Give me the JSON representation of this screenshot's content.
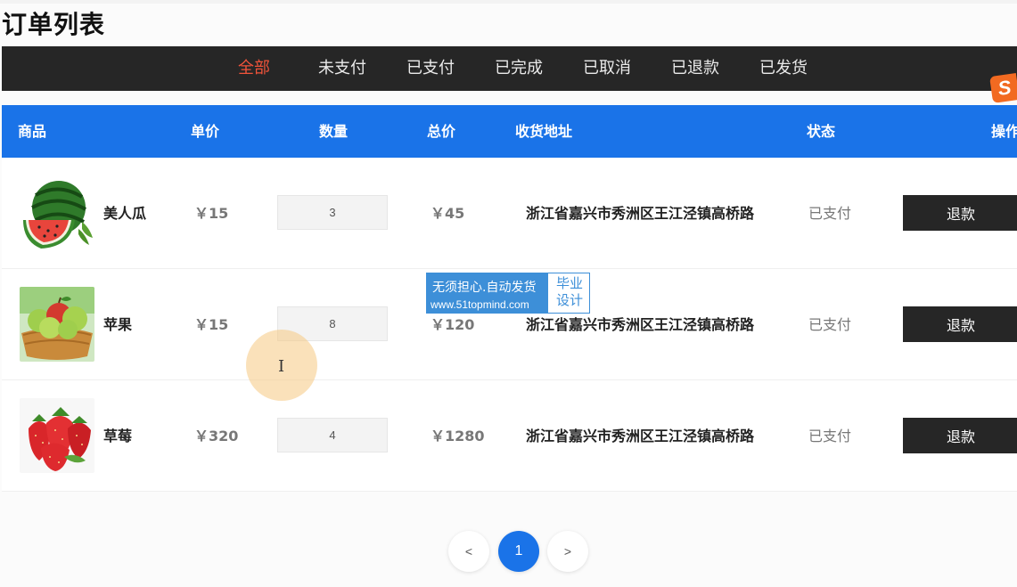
{
  "page_title": "订单列表",
  "filter_tabs": [
    {
      "label": "全部",
      "active": true
    },
    {
      "label": "未支付",
      "active": false
    },
    {
      "label": "已支付",
      "active": false
    },
    {
      "label": "已完成",
      "active": false
    },
    {
      "label": "已取消",
      "active": false
    },
    {
      "label": "已退款",
      "active": false
    },
    {
      "label": "已发货",
      "active": false
    }
  ],
  "table": {
    "headers": [
      "商品",
      "单价",
      "数量",
      "总价",
      "收货地址",
      "状态",
      "操作"
    ],
    "rows": [
      {
        "name": "美人瓜",
        "image": "watermelon",
        "price": "￥15",
        "quantity": "3",
        "total": "￥45",
        "address": "浙江省嘉兴市秀洲区王江泾镇高桥路",
        "status": "已支付",
        "action": "退款"
      },
      {
        "name": "苹果",
        "image": "apple",
        "price": "￥15",
        "quantity": "8",
        "total": "￥120",
        "address": "浙江省嘉兴市秀洲区王江泾镇高桥路",
        "status": "已支付",
        "action": "退款"
      },
      {
        "name": "草莓",
        "image": "strawberry",
        "price": "￥320",
        "quantity": "4",
        "total": "￥1280",
        "address": "浙江省嘉兴市秀洲区王江泾镇高桥路",
        "status": "已支付",
        "action": "退款"
      }
    ]
  },
  "pagination": {
    "prev": "<",
    "current": "1",
    "next": ">"
  },
  "watermark": {
    "line1": "无须担心.自动发货",
    "line2": "www.51topmind.com",
    "right_top": "毕业",
    "right_bottom": "设计"
  },
  "logo_badge": "S",
  "colors": {
    "accent": "#1a73e8",
    "active_tab": "#f0533a",
    "dark": "#262626"
  }
}
